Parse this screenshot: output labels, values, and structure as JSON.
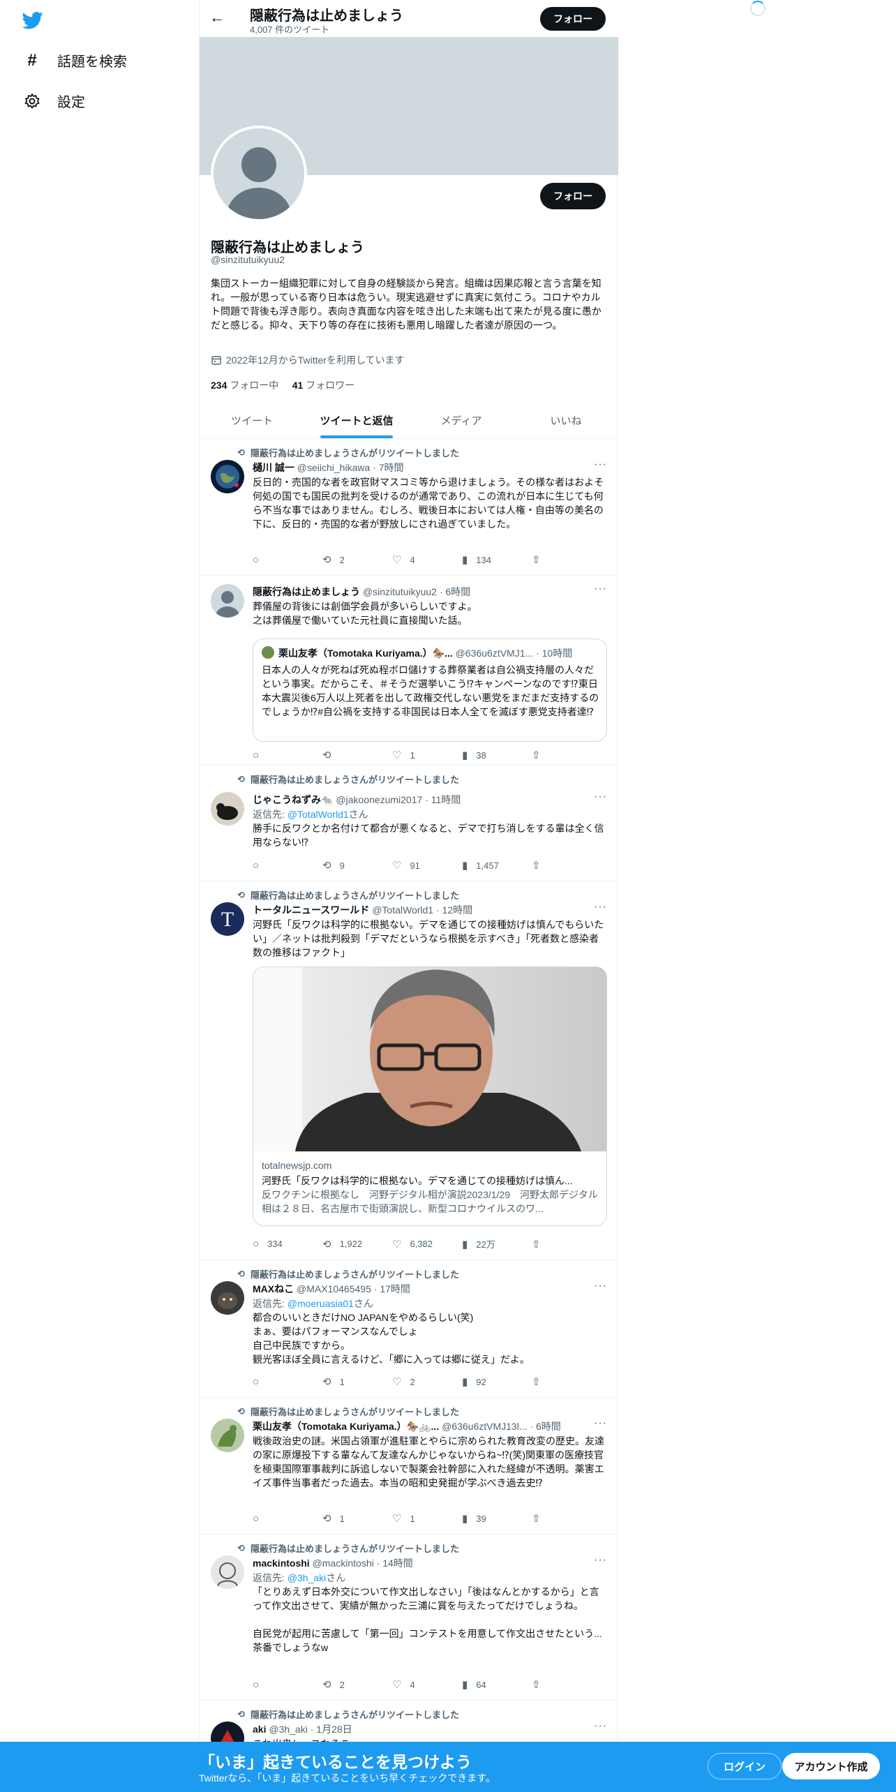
{
  "nav": {
    "explore_label": "話題を検索",
    "settings_label": "設定"
  },
  "header": {
    "title": "隠蔽行為は止めましょう",
    "tweet_count": "4,007 件のツイート",
    "follow_label": "フォロー"
  },
  "profile": {
    "name": "隠蔽行為は止めましょう",
    "handle": "@sinzitutuikyuu2",
    "follow_label": "フォロー",
    "bio": "集団ストーカー組織犯罪に対して自身の経験談から発言。組織は因果応報と言う言葉を知れ。一般が思っている寄り日本は危うい。現実逃避せずに真実に気付こう。コロナやカルト問題で背後も浮き彫り。表向き真面な内容を呟き出した末端も出て来たが見る度に愚かだと感じる。抑々、天下り等の存在に技術も悪用し暗躍した者達が原因の一つ。",
    "joined": "2022年12月からTwitterを利用しています",
    "following_count": "234",
    "following_label": "フォロー中",
    "followers_count": "41",
    "followers_label": "フォロワー"
  },
  "tabs": [
    "ツイート",
    "ツイートと返信",
    "メディア",
    "いいね"
  ],
  "retweet_label": "隠蔽行為は止めましょうさんがリツイートしました",
  "reply_prefix": "返信先: ",
  "reply_suffix": "さん",
  "tweets": [
    {
      "name": "樋川 誠一",
      "handle": "@seiichi_hikawa",
      "time": "7時間",
      "text": "反日的・売国的な者を政官財マスコミ等から退けましょう。その様な者はおよそ何処の国でも国民の批判を受けるのが通常であり、この流れが日本に生じても何ら不当な事ではありません。むしろ、戦後日本においては人権・自由等の美名の下に、反日的・売国的な者が野放しにされ過ぎていました。",
      "replies": "",
      "retweets": "2",
      "likes": "4",
      "views": "134"
    },
    {
      "name": "隠蔽行為は止めましょう",
      "handle": "@sinzitutuikyuu2",
      "time": "6時間",
      "text": "葬儀屋の背後には創価学会員が多いらしいですよ。\n之は葬儀屋で働いていた元社員に直接聞いた話。",
      "quote": {
        "name": "栗山友孝（Tomotaka Kuriyama.）🏇...",
        "handle": "@636u6ztVMJ1...",
        "time": "10時間",
        "text": "日本人の人々が死ねば死ぬ程ボロ儲けする葬祭業者は自公禍支持層の人々だという事実。だからこそ、＃そうだ選挙いこう⁉キャンペーンなのです⁉東日本大震災後6万人以上死者を出して政権交代しない悪党をまだまだ支持するのでしょうか⁉#自公禍を支持する非国民は日本人全てを滅ぼす悪党支持者達⁉"
      },
      "replies": "",
      "retweets": "",
      "likes": "1",
      "views": "38"
    },
    {
      "name": "じゃこうねずみ🐀",
      "handle": "@jakoonezumi2017",
      "time": "11時間",
      "reply_to": "@TotalWorld1",
      "text": "勝手に反ワクとか名付けて都合が悪くなると、デマで打ち消しをする輩は全く信用ならない⁉",
      "replies": "",
      "retweets": "9",
      "likes": "91",
      "views": "1,457"
    },
    {
      "name": "トータルニュースワールド",
      "handle": "@TotalWorld1",
      "time": "12時間",
      "text": "河野氏「反ワクは科学的に根拠ない。デマを通じての接種妨げは慎んでもらいたい」／ネットは批判殺到「デマだというなら根拠を示すべき」「死者数と感染者数の推移はファクト」",
      "card": {
        "domain": "totalnewsjp.com",
        "title": "河野氏「反ワクは科学的に根拠ない。デマを通じての接種妨げは慎ん...",
        "desc": "反ワクチンに根拠なし　河野デジタル相が演説2023/1/29　河野太郎デジタル相は２８日、名古屋市で街頭演説し、新型コロナウイルスのワ..."
      },
      "replies": "334",
      "retweets": "1,922",
      "likes": "6,382",
      "views": "22万"
    },
    {
      "name": "MAXねこ",
      "handle": "@MAX10465495",
      "time": "17時間",
      "reply_to": "@moeruasia01",
      "text": "都合のいいときだけNO JAPANをやめるらしい(笑)\nまぁ、要はパフォーマンスなんでしょ\n自己中民族ですから。\n観光客ほぼ全員に言えるけど、「郷に入っては郷に従え」だよ。",
      "replies": "",
      "retweets": "1",
      "likes": "2",
      "views": "92"
    },
    {
      "name": "栗山友孝（Tomotaka Kuriyama.）🏇🚲...",
      "handle": "@636u6ztVMJ13l...",
      "time": "6時間",
      "text": "戦後政治史の謎。米国占領軍が進駐軍とやらに宗められた教育改変の歴史。友達の家に原爆投下する輩なんて友達なんかじゃないからね~⁉(笑)関東軍の医療技官を極東国際軍事裁判に訴追しないで製薬会社幹部に入れた経緯が不透明。薬害エイズ事件当事者だった過去。本当の昭和史発掘が学ぶべき過去史⁉",
      "replies": "",
      "retweets": "1",
      "likes": "1",
      "views": "39"
    },
    {
      "name": "mackintoshi",
      "handle": "@mackintoshi",
      "time": "14時間",
      "reply_to": "@3h_aki",
      "text": "「とりあえず日本外交について作文出しなさい」「後はなんとかするから」と言って作文出させて、実績が無かった三浦に賞を与えたってだけでしょうね。\n\n自民党が起用に苦慮して「第一回」コンテストを用意して作文出させたという...茶番でしょうなw",
      "replies": "",
      "retweets": "2",
      "likes": "4",
      "views": "64"
    },
    {
      "name": "aki",
      "handle": "@3h_aki",
      "time": "1月28日",
      "text": "これ出来レースなるこ..."
    }
  ],
  "bottom": {
    "title": "「いま」起きていることを見つけよう",
    "subtitle": "Twitterなら、「いま」起きていることをいち早くチェックできます。",
    "login": "ログイン",
    "signup": "アカウント作成"
  }
}
